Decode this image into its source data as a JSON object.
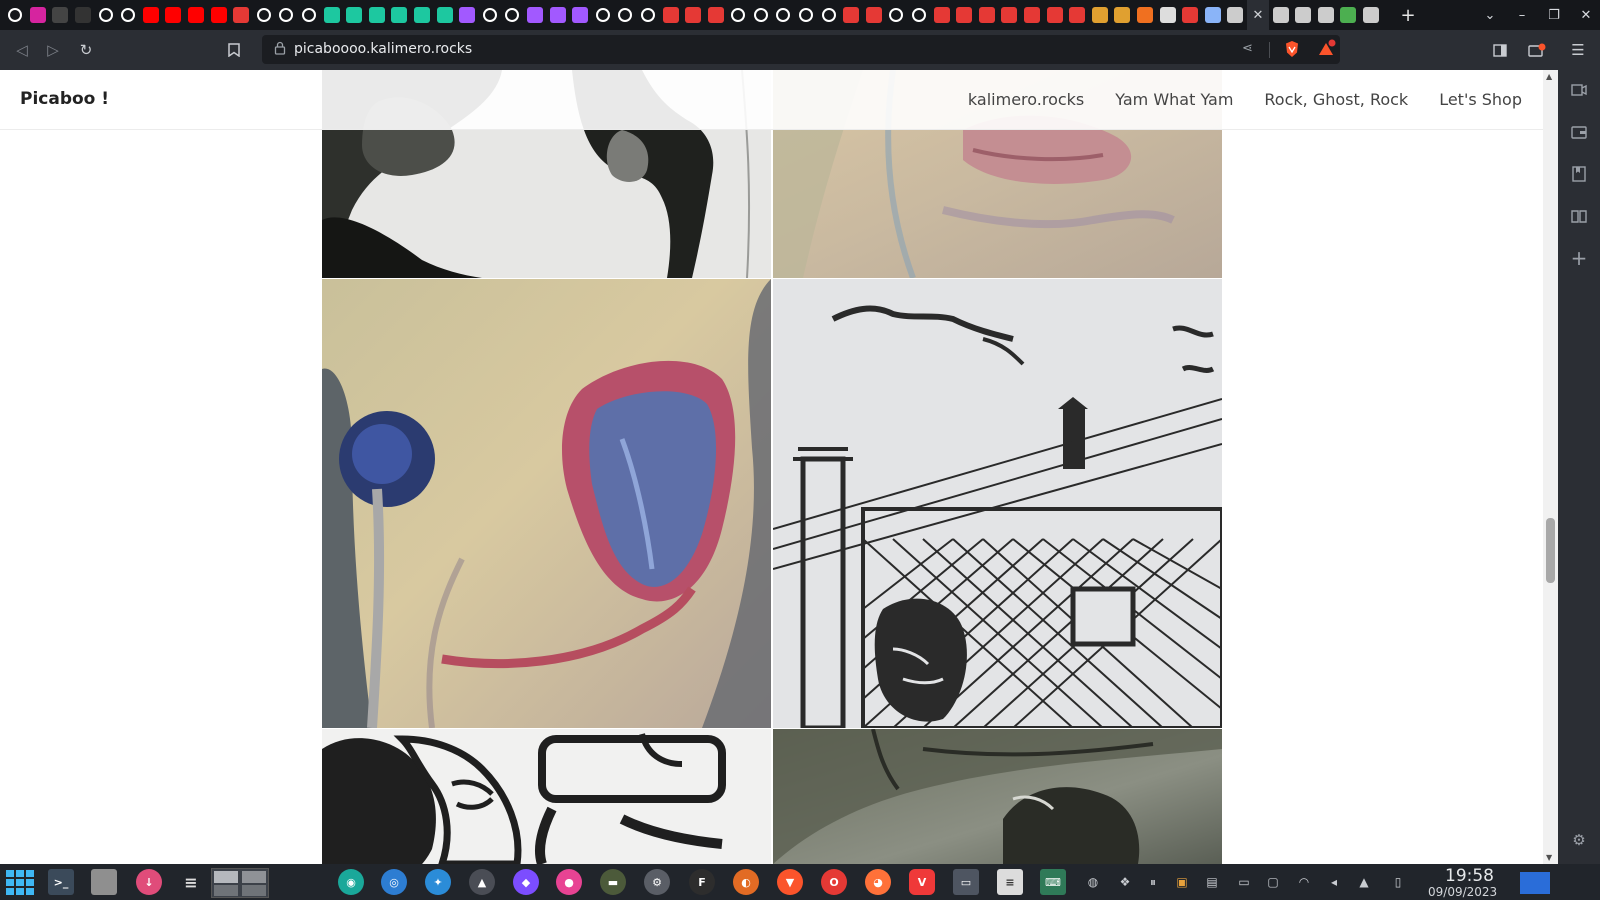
{
  "browser": {
    "url": "picaboooo.kalimero.rocks",
    "tabs": [
      {
        "icon": "notion-icon",
        "color": "#ffffff"
      },
      {
        "icon": "instagram-icon",
        "color": "#d6249f"
      },
      {
        "icon": "misc-icon",
        "color": "#444444"
      },
      {
        "icon": "github-icon",
        "color": "#333333"
      },
      {
        "icon": "github-icon",
        "color": "#ffffff"
      },
      {
        "icon": "github-icon",
        "color": "#ffffff"
      },
      {
        "icon": "youtube-icon",
        "color": "#ff0000"
      },
      {
        "icon": "youtube-icon",
        "color": "#ff0000"
      },
      {
        "icon": "youtube-icon",
        "color": "#ff0000"
      },
      {
        "icon": "youtube-icon",
        "color": "#ff0000"
      },
      {
        "icon": "pin-icon",
        "color": "#e53935"
      },
      {
        "icon": "triangle-icon",
        "color": "#ffffff"
      },
      {
        "icon": "github-icon",
        "color": "#ffffff"
      },
      {
        "icon": "misc-icon",
        "color": "#ffffff"
      },
      {
        "icon": "feather-icon",
        "color": "#1dc8a0"
      },
      {
        "icon": "feather-icon",
        "color": "#1dc8a0"
      },
      {
        "icon": "feather-icon",
        "color": "#1dc8a0"
      },
      {
        "icon": "feather-icon",
        "color": "#1dc8a0"
      },
      {
        "icon": "feather-icon",
        "color": "#1dc8a0"
      },
      {
        "icon": "feather-icon",
        "color": "#1dc8a0"
      },
      {
        "icon": "figma-icon",
        "color": "#a259ff"
      },
      {
        "icon": "misc-icon",
        "color": "#ffffff"
      },
      {
        "icon": "cube-icon",
        "color": "#ffffff"
      },
      {
        "icon": "figma-icon",
        "color": "#a259ff"
      },
      {
        "icon": "figma-icon",
        "color": "#a259ff"
      },
      {
        "icon": "figma-icon",
        "color": "#a259ff"
      },
      {
        "icon": "github-icon",
        "color": "#ffffff"
      },
      {
        "icon": "github-icon",
        "color": "#ffffff"
      },
      {
        "icon": "github-icon",
        "color": "#ffffff"
      },
      {
        "icon": "notion-icon",
        "color": "#e53935"
      },
      {
        "icon": "pin-icon",
        "color": "#e53935"
      },
      {
        "icon": "pin-icon",
        "color": "#e53935"
      },
      {
        "icon": "loading-icon",
        "color": "#ffffff"
      },
      {
        "icon": "loading-icon",
        "color": "#ffffff"
      },
      {
        "icon": "github-icon",
        "color": "#ffffff"
      },
      {
        "icon": "loading-icon",
        "color": "#ffffff"
      },
      {
        "icon": "loading-icon",
        "color": "#ffffff"
      },
      {
        "icon": "pin-icon",
        "color": "#e53935"
      },
      {
        "icon": "pin-icon",
        "color": "#e53935"
      },
      {
        "icon": "github-icon",
        "color": "#ffffff"
      },
      {
        "icon": "github-icon",
        "color": "#ffffff"
      },
      {
        "icon": "pin-icon",
        "color": "#e53935"
      },
      {
        "icon": "pin-icon",
        "color": "#e53935"
      },
      {
        "icon": "pin-icon",
        "color": "#e53935"
      },
      {
        "icon": "pin-icon",
        "color": "#e53935"
      },
      {
        "icon": "pin-icon",
        "color": "#e53935"
      },
      {
        "icon": "pin-icon",
        "color": "#e53935"
      },
      {
        "icon": "pin-icon",
        "color": "#e53935"
      },
      {
        "icon": "ai-icon",
        "color": "#e0a030"
      },
      {
        "icon": "ai-icon",
        "color": "#e0a030"
      },
      {
        "icon": "doc-icon",
        "color": "#f07020"
      },
      {
        "icon": "globe-icon",
        "color": "#dddddd"
      },
      {
        "icon": "app-icon",
        "color": "#e53935"
      },
      {
        "icon": "misc-icon",
        "color": "#8ab4f8"
      },
      {
        "icon": "brave-search-icon",
        "color": "#cccccc"
      },
      {
        "icon": "tab-close-icon",
        "color": "#ffffff",
        "active": true
      },
      {
        "icon": "brave-search-icon",
        "color": "#cccccc"
      },
      {
        "icon": "brave-search-icon",
        "color": "#cccccc"
      },
      {
        "icon": "brave-search-icon",
        "color": "#cccccc"
      },
      {
        "icon": "shield-icon",
        "color": "#4caf50"
      },
      {
        "icon": "brave-search-icon",
        "color": "#cccccc"
      }
    ],
    "new_tab_label": "+",
    "window_controls": [
      "⌄",
      "–",
      "❐",
      "✕"
    ]
  },
  "site": {
    "title": "Picaboo !",
    "nav": [
      "kalimero.rocks",
      "Yam What Yam",
      "Rock, Ghost, Rock",
      "Let's Shop"
    ]
  },
  "gallery": {
    "artworks": [
      {
        "id": "ink-abstract-top",
        "style": "ink wash"
      },
      {
        "id": "pastel-lips-top",
        "style": "oil pastel"
      },
      {
        "id": "pastel-tongue",
        "style": "oil pastel"
      },
      {
        "id": "ink-water-tower",
        "style": "ink drawing"
      },
      {
        "id": "ink-comic-face",
        "style": "ink drawing"
      },
      {
        "id": "charcoal-figure",
        "style": "charcoal"
      }
    ]
  },
  "taskbar": {
    "apps": [
      "start-menu-icon",
      "terminal-icon",
      "files-icon",
      "downloader-icon",
      "zed-icon",
      "workspaces-icon",
      "camera-icon",
      "browser-icon",
      "bird-icon",
      "vpn-icon",
      "obsidian-icon",
      "colors-icon",
      "tank-icon",
      "settings-icon",
      "figma-icon",
      "app-orange-icon",
      "brave-icon",
      "opera-icon",
      "firefox-icon",
      "vivaldi-icon",
      "monitor-icon",
      "clipboard-icon",
      "keyboard-icon"
    ],
    "tray": [
      "globe-icon",
      "dropbox-icon",
      "pause-icon",
      "package-icon",
      "clipboard-icon",
      "battery-icon",
      "display-icon",
      "wifi-icon",
      "volume-icon",
      "arrow-up-icon",
      "phone-icon"
    ],
    "clock": {
      "time": "19:58",
      "date": "09/09/2023"
    }
  }
}
